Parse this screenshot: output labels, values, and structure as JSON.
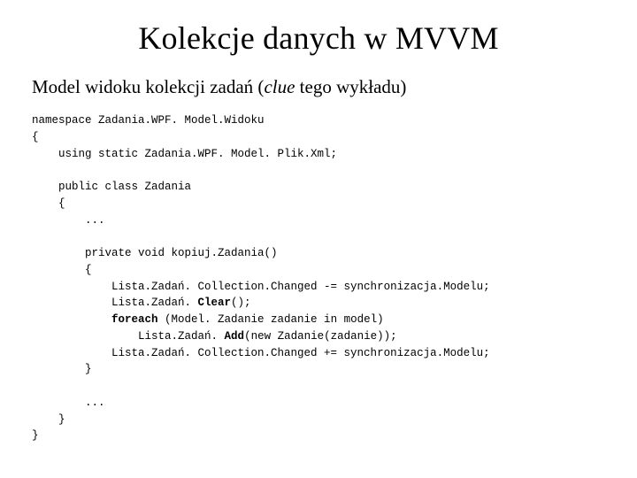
{
  "title": "Kolekcje danych w MVVM",
  "subtitle": {
    "prefix": "Model widoku kolekcji zadań (",
    "italic": "clue",
    "suffix": " tego wykładu)"
  },
  "code": {
    "l01": "namespace Zadania.WPF. Model.Widoku",
    "l02": "{",
    "l03": "    using static Zadania.WPF. Model. Plik.Xml;",
    "l04": "",
    "l05": "    public class Zadania",
    "l06": "    {",
    "l07": "        ...",
    "l08": "",
    "l09": "        private void kopiuj.Zadania()",
    "l10": "        {",
    "l11": "            Lista.Zadań. Collection.Changed -= synchronizacja.Modelu;",
    "l12a": "            Lista.Zadań. ",
    "l12b": "Clear",
    "l12c": "();",
    "l13a": "            ",
    "l13b": "foreach",
    "l13c": " (Model. Zadanie zadanie in model)",
    "l14a": "                Lista.Zadań. ",
    "l14b": "Add",
    "l14c": "(new Zadanie(zadanie));",
    "l15": "            Lista.Zadań. Collection.Changed += synchronizacja.Modelu;",
    "l16": "        }",
    "l17": "",
    "l18": "        ...",
    "l19": "    }",
    "l20": "}"
  }
}
